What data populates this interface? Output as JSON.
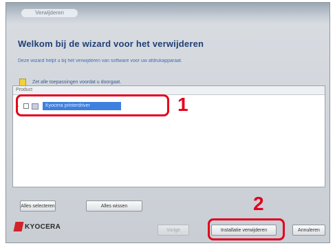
{
  "window": {
    "title": "Verwijderen",
    "heading": "Welkom bij de wizard voor het verwijderen",
    "subtext": "Deze wizard helpt u bij het verwijderen van software voor uw afdrukapparaat.",
    "warning": "Zet alle toepassingen voordat u doorgaat."
  },
  "list": {
    "header": "Product",
    "items": [
      {
        "expander": "−",
        "label": "Kyocera printerdriver"
      }
    ]
  },
  "buttons": {
    "select_all": "Alles selecteren",
    "clear_all": "Alles wissen",
    "back": "Vorige",
    "uninstall": "Installatie verwijderen",
    "cancel": "Annuleren"
  },
  "brand": {
    "name": "KYOCERA",
    "color": "#d1232a"
  },
  "annotations": {
    "callout_1": "1",
    "callout_2": "2",
    "highlight_color": "#e3001b"
  }
}
